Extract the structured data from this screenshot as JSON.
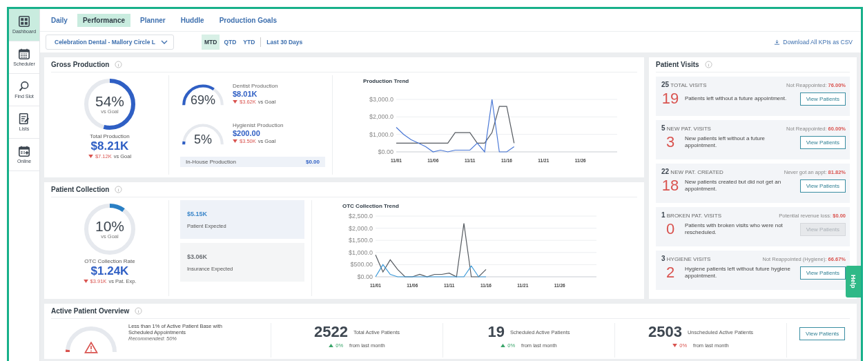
{
  "sidebar": {
    "items": [
      {
        "kind": "dashboard",
        "label": "Dashboard",
        "selected": true
      },
      {
        "kind": "calendar",
        "label": "Scheduler",
        "selected": false
      },
      {
        "kind": "search",
        "label": "Find Slot",
        "selected": false
      },
      {
        "kind": "list",
        "label": "Lists",
        "selected": false
      },
      {
        "kind": "calendar-plus",
        "label": "Online",
        "selected": false
      }
    ]
  },
  "tabs": [
    {
      "label": "Daily",
      "selected": false
    },
    {
      "label": "Performance",
      "selected": true
    },
    {
      "label": "Planner",
      "selected": false
    },
    {
      "label": "Huddle",
      "selected": false
    },
    {
      "label": "Production Goals",
      "selected": false
    }
  ],
  "location_select": {
    "value": "Celebration Dental - Mallory Circle L"
  },
  "periods": [
    {
      "label": "MTD",
      "selected": true
    },
    {
      "label": "QTD",
      "selected": false
    },
    {
      "label": "YTD",
      "selected": false
    },
    {
      "label": "Last 30 Days",
      "selected": false
    }
  ],
  "download_link": "Download All KPIs as CSV",
  "gross_production": {
    "title": "Gross Production",
    "total": {
      "level": 0.54,
      "percent": "54%",
      "caption": "vs Goal",
      "label": "Total Production",
      "value": "$8.21K",
      "delta": "$7.12K",
      "delta_suffix": "vs Goal"
    },
    "gauges": [
      {
        "percent": "69%",
        "label": "Dentist Production",
        "value": "$8.01K",
        "delta": "$3.62K",
        "delta_suffix": "vs Goal"
      },
      {
        "percent": "5%",
        "label": "Hygienist Production",
        "value": "$200.00",
        "delta": "$3.50K",
        "delta_suffix": "vs Goal"
      }
    ],
    "in_house": {
      "label": "In-House Production",
      "value": "$0.00"
    },
    "chart_data": {
      "type": "line",
      "title": "Production Trend",
      "categories": [
        "11/01",
        null,
        null,
        null,
        null,
        "11/06",
        null,
        null,
        null,
        null,
        "11/11",
        null,
        null,
        null,
        null,
        "11/16",
        null,
        null,
        null,
        null,
        "11/21",
        null,
        null,
        null,
        null,
        "11/26",
        null,
        null,
        null,
        null
      ],
      "ylim": [
        0,
        3000
      ],
      "grid": true,
      "yticks": [
        {
          "value": 0,
          "label": "$0.00"
        },
        {
          "value": 1000,
          "label": "$1,000.0"
        },
        {
          "value": 2000,
          "label": "$2,000.0"
        },
        {
          "value": 3000,
          "label": "$3,000.0"
        }
      ],
      "series": [
        {
          "color": "#555a60",
          "values": [
            500,
            500,
            500,
            500,
            500,
            500,
            500,
            500,
            1100,
            1100,
            1100,
            500,
            500,
            1100,
            2600,
            2600,
            500,
            null,
            null,
            null,
            null,
            null,
            null,
            null,
            null,
            null,
            null,
            null,
            null,
            null
          ]
        },
        {
          "color": "#4a78d6",
          "values": [
            1400,
            1000,
            700,
            500,
            300,
            0,
            100,
            0,
            100,
            100,
            100,
            500,
            0,
            3000,
            0,
            0,
            300,
            null,
            null,
            null,
            null,
            null,
            null,
            null,
            null,
            null,
            null,
            null,
            null,
            null
          ]
        }
      ]
    }
  },
  "patient_collection": {
    "title": "Patient Collection",
    "total": {
      "level": 0.1,
      "percent": "10%",
      "caption": "vs Goal",
      "label": "OTC Collection Rate",
      "value": "$1.24K",
      "delta": "$3.91K",
      "delta_suffix": "vs Pat. Exp."
    },
    "tiles": [
      {
        "value": "$5.15K",
        "label": "Patient Expected",
        "color": "#3b86c9"
      },
      {
        "value": "$3.06K",
        "label": "Insurance Expected",
        "color": "#6b6f74"
      }
    ],
    "chart_data": {
      "type": "line",
      "title": "OTC Collection Trend",
      "categories": [
        "11/01",
        null,
        null,
        null,
        null,
        "11/06",
        null,
        null,
        null,
        null,
        "11/11",
        null,
        null,
        null,
        null,
        "11/16",
        null,
        null,
        null,
        null,
        "11/21",
        null,
        null,
        null,
        null,
        "11/26",
        null,
        null,
        null,
        null
      ],
      "ylim": [
        0,
        2500
      ],
      "grid": true,
      "yticks": [
        {
          "value": 0,
          "label": "$0.00"
        },
        {
          "value": 500,
          "label": "$500.00"
        },
        {
          "value": 1000,
          "label": "$1,000.0"
        },
        {
          "value": 1500,
          "label": "$1,500.0"
        },
        {
          "value": 2000,
          "label": "$2,000.0"
        },
        {
          "value": 2500,
          "label": "$2,500.0"
        }
      ],
      "series": [
        {
          "color": "#555a60",
          "values": [
            900,
            200,
            700,
            300,
            0,
            0,
            100,
            0,
            100,
            100,
            150,
            0,
            2200,
            0,
            0,
            300,
            null,
            null,
            null,
            null,
            null,
            null,
            null,
            null,
            null,
            null,
            null,
            null,
            null,
            null
          ]
        },
        {
          "color": "#3b9ad9",
          "values": [
            0,
            500,
            100,
            0,
            0,
            0,
            0,
            0,
            0,
            0,
            0,
            0,
            0,
            450,
            0,
            0,
            null,
            null,
            null,
            null,
            null,
            null,
            null,
            null,
            null,
            null,
            null,
            null,
            null,
            null
          ]
        }
      ]
    }
  },
  "patient_visits": {
    "title": "Patient Visits",
    "items": [
      {
        "count": "25",
        "label": "TOTAL VISITS",
        "metric_label": "Not Reappointed:",
        "metric_value": "76.00%",
        "number": "19",
        "description": "Patients left without a future appointment.",
        "button": "View Patients",
        "disabled": false
      },
      {
        "count": "5",
        "label": "NEW PAT. VISITS",
        "metric_label": "Not Reappointed:",
        "metric_value": "60.00%",
        "number": "3",
        "description": "New patients left without a future appointment.",
        "button": "View Patients",
        "disabled": false
      },
      {
        "count": "22",
        "label": "NEW PAT. CREATED",
        "metric_label": "Never got an appt:",
        "metric_value": "81.82%",
        "number": "18",
        "description": "New patients created but did not get an appointment.",
        "button": "View Patients",
        "disabled": false
      },
      {
        "count": "1",
        "label": "BROKEN PAT. VISITS",
        "metric_label": "Potential revenue loss:",
        "metric_value": "$0.00",
        "number": "0",
        "description": "Patients with broken visits who were not rescheduled.",
        "button": "View Patients",
        "disabled": true
      },
      {
        "count": "3",
        "label": "HYGIENE VISITS",
        "metric_label": "Not Reappointed (Hygiene):",
        "metric_value": "66.67%",
        "number": "2",
        "description": "Hygiene patients left without future hygiene appointment.",
        "button": "View Patients",
        "disabled": false
      }
    ]
  },
  "active_patient_overview": {
    "title": "Active Patient Overview",
    "gauge": {
      "text": "Less than 1% of Active Patient Base with Scheduled Appointments",
      "recommendation": "Recommended: 50%"
    },
    "stats": [
      {
        "value": "2522",
        "label": "Total Active Patients",
        "kind": "up",
        "change": "0%",
        "period": "from last month"
      },
      {
        "value": "19",
        "label": "Scheduled Active Patients",
        "kind": "up",
        "change": "0%",
        "period": "from last month"
      },
      {
        "value": "2503",
        "label": "Unscheduled Active Patients",
        "kind": "down",
        "change": "0%",
        "period": "from last month"
      }
    ],
    "button": "View Patients"
  },
  "help_tab": "Help"
}
